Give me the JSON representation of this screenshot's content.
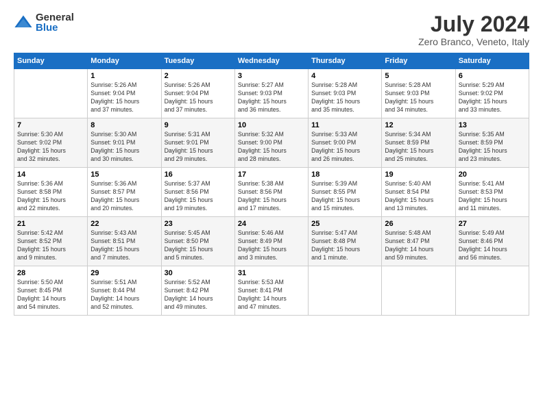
{
  "logo": {
    "general": "General",
    "blue": "Blue"
  },
  "title": "July 2024",
  "subtitle": "Zero Branco, Veneto, Italy",
  "days_of_week": [
    "Sunday",
    "Monday",
    "Tuesday",
    "Wednesday",
    "Thursday",
    "Friday",
    "Saturday"
  ],
  "weeks": [
    [
      {
        "day": "",
        "info": ""
      },
      {
        "day": "1",
        "info": "Sunrise: 5:26 AM\nSunset: 9:04 PM\nDaylight: 15 hours\nand 37 minutes."
      },
      {
        "day": "2",
        "info": "Sunrise: 5:26 AM\nSunset: 9:04 PM\nDaylight: 15 hours\nand 37 minutes."
      },
      {
        "day": "3",
        "info": "Sunrise: 5:27 AM\nSunset: 9:03 PM\nDaylight: 15 hours\nand 36 minutes."
      },
      {
        "day": "4",
        "info": "Sunrise: 5:28 AM\nSunset: 9:03 PM\nDaylight: 15 hours\nand 35 minutes."
      },
      {
        "day": "5",
        "info": "Sunrise: 5:28 AM\nSunset: 9:03 PM\nDaylight: 15 hours\nand 34 minutes."
      },
      {
        "day": "6",
        "info": "Sunrise: 5:29 AM\nSunset: 9:02 PM\nDaylight: 15 hours\nand 33 minutes."
      }
    ],
    [
      {
        "day": "7",
        "info": "Sunrise: 5:30 AM\nSunset: 9:02 PM\nDaylight: 15 hours\nand 32 minutes."
      },
      {
        "day": "8",
        "info": "Sunrise: 5:30 AM\nSunset: 9:01 PM\nDaylight: 15 hours\nand 30 minutes."
      },
      {
        "day": "9",
        "info": "Sunrise: 5:31 AM\nSunset: 9:01 PM\nDaylight: 15 hours\nand 29 minutes."
      },
      {
        "day": "10",
        "info": "Sunrise: 5:32 AM\nSunset: 9:00 PM\nDaylight: 15 hours\nand 28 minutes."
      },
      {
        "day": "11",
        "info": "Sunrise: 5:33 AM\nSunset: 9:00 PM\nDaylight: 15 hours\nand 26 minutes."
      },
      {
        "day": "12",
        "info": "Sunrise: 5:34 AM\nSunset: 8:59 PM\nDaylight: 15 hours\nand 25 minutes."
      },
      {
        "day": "13",
        "info": "Sunrise: 5:35 AM\nSunset: 8:59 PM\nDaylight: 15 hours\nand 23 minutes."
      }
    ],
    [
      {
        "day": "14",
        "info": "Sunrise: 5:36 AM\nSunset: 8:58 PM\nDaylight: 15 hours\nand 22 minutes."
      },
      {
        "day": "15",
        "info": "Sunrise: 5:36 AM\nSunset: 8:57 PM\nDaylight: 15 hours\nand 20 minutes."
      },
      {
        "day": "16",
        "info": "Sunrise: 5:37 AM\nSunset: 8:56 PM\nDaylight: 15 hours\nand 19 minutes."
      },
      {
        "day": "17",
        "info": "Sunrise: 5:38 AM\nSunset: 8:56 PM\nDaylight: 15 hours\nand 17 minutes."
      },
      {
        "day": "18",
        "info": "Sunrise: 5:39 AM\nSunset: 8:55 PM\nDaylight: 15 hours\nand 15 minutes."
      },
      {
        "day": "19",
        "info": "Sunrise: 5:40 AM\nSunset: 8:54 PM\nDaylight: 15 hours\nand 13 minutes."
      },
      {
        "day": "20",
        "info": "Sunrise: 5:41 AM\nSunset: 8:53 PM\nDaylight: 15 hours\nand 11 minutes."
      }
    ],
    [
      {
        "day": "21",
        "info": "Sunrise: 5:42 AM\nSunset: 8:52 PM\nDaylight: 15 hours\nand 9 minutes."
      },
      {
        "day": "22",
        "info": "Sunrise: 5:43 AM\nSunset: 8:51 PM\nDaylight: 15 hours\nand 7 minutes."
      },
      {
        "day": "23",
        "info": "Sunrise: 5:45 AM\nSunset: 8:50 PM\nDaylight: 15 hours\nand 5 minutes."
      },
      {
        "day": "24",
        "info": "Sunrise: 5:46 AM\nSunset: 8:49 PM\nDaylight: 15 hours\nand 3 minutes."
      },
      {
        "day": "25",
        "info": "Sunrise: 5:47 AM\nSunset: 8:48 PM\nDaylight: 15 hours\nand 1 minute."
      },
      {
        "day": "26",
        "info": "Sunrise: 5:48 AM\nSunset: 8:47 PM\nDaylight: 14 hours\nand 59 minutes."
      },
      {
        "day": "27",
        "info": "Sunrise: 5:49 AM\nSunset: 8:46 PM\nDaylight: 14 hours\nand 56 minutes."
      }
    ],
    [
      {
        "day": "28",
        "info": "Sunrise: 5:50 AM\nSunset: 8:45 PM\nDaylight: 14 hours\nand 54 minutes."
      },
      {
        "day": "29",
        "info": "Sunrise: 5:51 AM\nSunset: 8:44 PM\nDaylight: 14 hours\nand 52 minutes."
      },
      {
        "day": "30",
        "info": "Sunrise: 5:52 AM\nSunset: 8:42 PM\nDaylight: 14 hours\nand 49 minutes."
      },
      {
        "day": "31",
        "info": "Sunrise: 5:53 AM\nSunset: 8:41 PM\nDaylight: 14 hours\nand 47 minutes."
      },
      {
        "day": "",
        "info": ""
      },
      {
        "day": "",
        "info": ""
      },
      {
        "day": "",
        "info": ""
      }
    ]
  ]
}
